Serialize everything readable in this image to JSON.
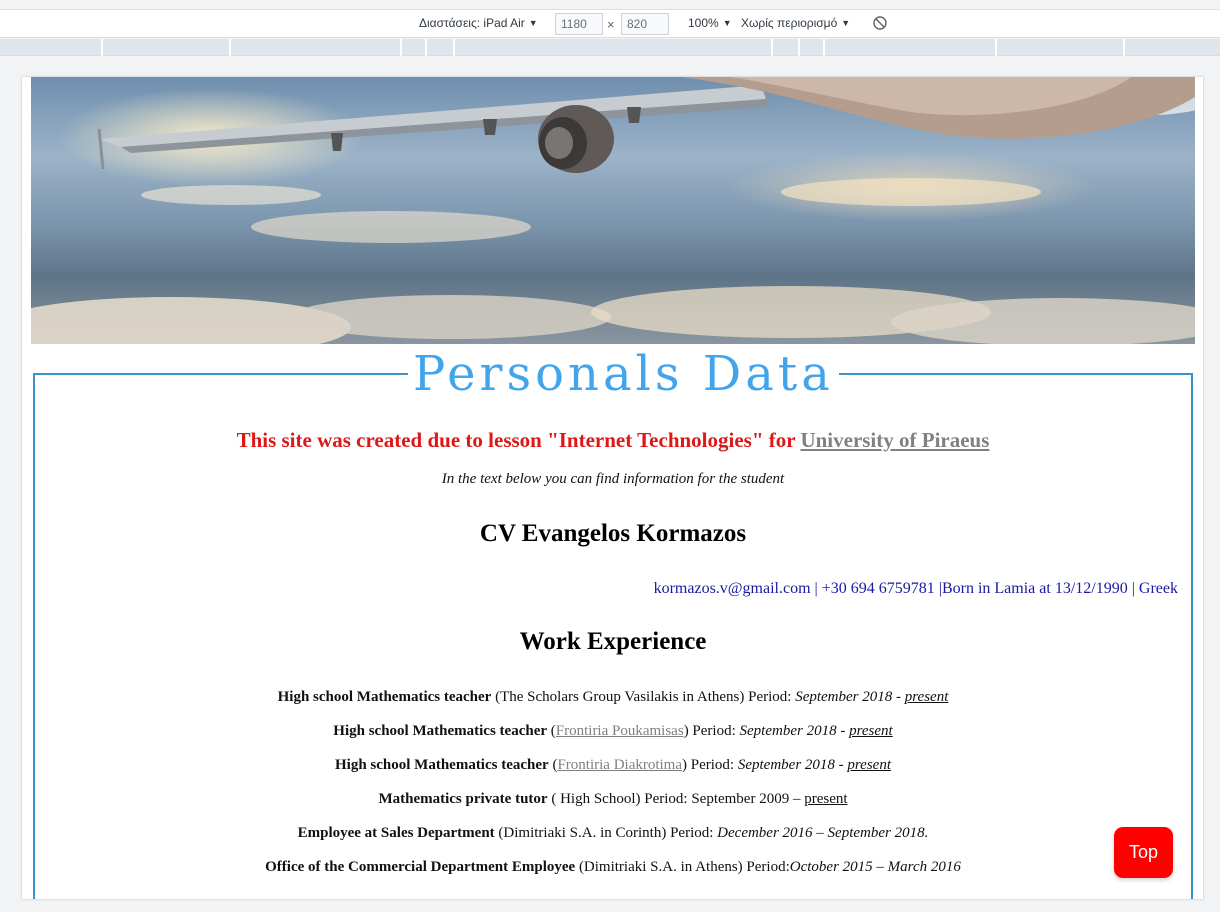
{
  "devtools": {
    "dimensions_label": "Διαστάσεις: iPad Air",
    "width_value": "1180",
    "height_value": "820",
    "times_symbol": "×",
    "zoom_label": "100%",
    "throttle_label": "Χωρίς περιορισμό"
  },
  "page": {
    "legend_title": "Personals Data",
    "intro_text": "This site was created due to lesson \"Internet Technologies\" for ",
    "intro_link": "University of Piraeus",
    "subtitle": "In the text below you can find information for the student",
    "cv_title": "CV Evangelos Kormazos",
    "contact": {
      "email": "kormazos.v@gmail.com",
      "sep1": " | ",
      "phone": "+30 694 6759781",
      "sep2": " |",
      "birth": "Born in Lamia at 13/12/1990",
      "sep3": " | ",
      "nationality": "Greek"
    },
    "work_title": "Work Experience",
    "jobs": [
      {
        "role": "High school Mathematics teacher",
        "pre": " (The Scholars Group Vasilakis in Athens) Period: ",
        "link": "",
        "post": "",
        "period": "September 2018 - ",
        "end": "present"
      },
      {
        "role": "High school Mathematics teacher",
        "pre": " (",
        "link": "Frontiria Poukamisas",
        "post": ") Period: ",
        "period": "September 2018 - ",
        "end": "present"
      },
      {
        "role": "High school Mathematics teacher",
        "pre": " (",
        "link": "Frontiria Diakrotima",
        "post": ") Period: ",
        "period": "September 2018 - ",
        "end": "present"
      },
      {
        "role": "Mathematics private tutor",
        "pre": " ( High School) Period: September 2009 – ",
        "link": "",
        "post": "",
        "period": "",
        "end": "present"
      },
      {
        "role": "Employee at Sales Department",
        "pre": " (Dimitriaki S.A. in Corinth) Period: ",
        "link": "",
        "post": "",
        "period": "December 2016 – September 2018.",
        "end": ""
      },
      {
        "role": "Office of the Commercial Department Employee",
        "pre": " (Dimitriaki S.A. in Athens) Period:",
        "link": "",
        "post": "",
        "period": "October 2015 – March 2016",
        "end": ""
      }
    ],
    "top_button": "Top"
  },
  "colors": {
    "legend": "#42a5ec",
    "border": "#3a93c9",
    "intro": "#dd1818",
    "contact": "#1a1aa0",
    "top_button": "#ff0000"
  }
}
